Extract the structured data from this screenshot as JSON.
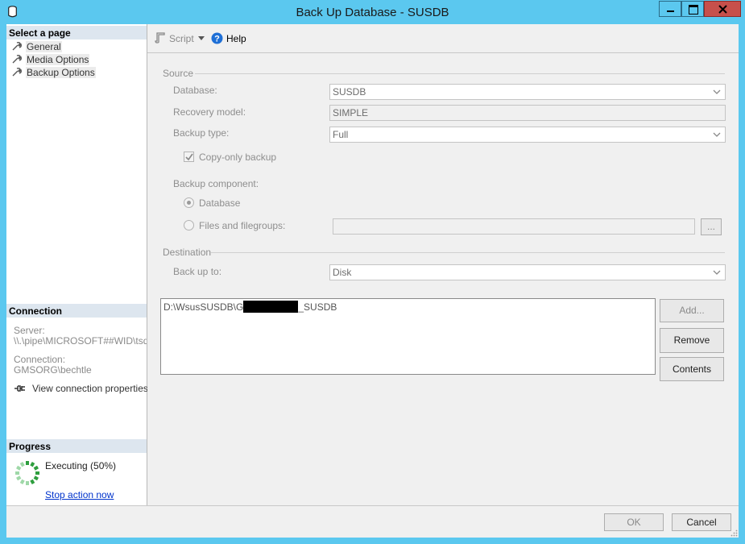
{
  "window": {
    "title": "Back Up Database - SUSDB",
    "accent_color": "#5bc8ef",
    "close_color": "#c7504b"
  },
  "left_pane": {
    "select_a_page": "Select a page",
    "pages": [
      {
        "label": "General",
        "icon": "wrench-icon"
      },
      {
        "label": "Media Options",
        "icon": "wrench-icon"
      },
      {
        "label": "Backup Options",
        "icon": "wrench-icon"
      }
    ],
    "connection": {
      "header": "Connection",
      "server_label": "Server:",
      "server_value": "\\\\.\\pipe\\MICROSOFT##WID\\tsql\\",
      "connection_label": "Connection:",
      "connection_value": "GMSORG\\bechtle",
      "view_properties": "View connection properties"
    },
    "progress": {
      "header": "Progress",
      "status": "Executing (50%)",
      "stop_link": "Stop action now",
      "percent": 50
    }
  },
  "toolbar": {
    "script_label": "Script",
    "help_label": "Help"
  },
  "source": {
    "group_label": "Source",
    "database_label": "Database:",
    "database_value": "SUSDB",
    "recovery_label": "Recovery model:",
    "recovery_value": "SIMPLE",
    "backup_type_label": "Backup type:",
    "backup_type_value": "Full",
    "copy_only_label": "Copy-only backup",
    "copy_only_checked": true,
    "component_label": "Backup component:",
    "component_database": "Database",
    "component_files": "Files and filegroups:",
    "files_value": "",
    "browse_label": "..."
  },
  "destination": {
    "group_label": "Destination",
    "back_up_to_label": "Back up to:",
    "back_up_to_value": "Disk",
    "paths": [
      {
        "prefix": "D:\\WsusSUSDB\\G",
        "suffix": "_SUSDB"
      }
    ],
    "add_label": "Add...",
    "remove_label": "Remove",
    "contents_label": "Contents"
  },
  "footer": {
    "ok_label": "OK",
    "cancel_label": "Cancel"
  }
}
